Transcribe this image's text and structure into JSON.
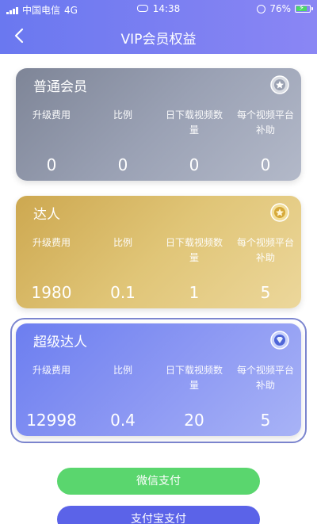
{
  "status_bar": {
    "carrier": "中国电信",
    "network": "4G",
    "time": "14:38",
    "battery": "76%"
  },
  "nav": {
    "title": "VIP会员权益",
    "back_icon": "chevron-left-icon"
  },
  "cards": [
    {
      "title": "普通会员",
      "badge_icon": "silver-medal-icon",
      "labels": [
        "升级费用",
        "比例",
        "日下载视频数量",
        "每个视频平台补助"
      ],
      "values": [
        "0",
        "0",
        "0",
        "0"
      ]
    },
    {
      "title": "达人",
      "badge_icon": "gold-medal-icon",
      "labels": [
        "升级费用",
        "比例",
        "日下载视频数量",
        "每个视频平台补助"
      ],
      "values": [
        "1980",
        "0.1",
        "1",
        "5"
      ]
    },
    {
      "title": "超级达人",
      "badge_icon": "diamond-medal-icon",
      "labels": [
        "升级费用",
        "比例",
        "日下载视频数量",
        "每个视频平台补助"
      ],
      "values": [
        "12998",
        "0.4",
        "20",
        "5"
      ]
    }
  ],
  "buttons": {
    "wechat_pay": "微信支付",
    "alipay": "支付宝支付"
  },
  "colors": {
    "header": "#7078f0",
    "card_normal": "#8f96a8",
    "card_daren": "#d9bb66",
    "card_super": "#7c8af1",
    "wechat_button": "#5ad66e",
    "alipay_button": "#5b63e8"
  }
}
